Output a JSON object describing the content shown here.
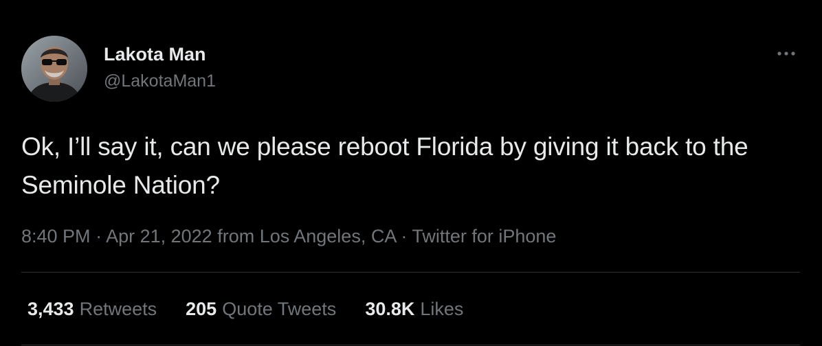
{
  "author": {
    "name": "Lakota Man",
    "handle": "@LakotaMan1"
  },
  "tweet": {
    "text": "Ok, I’ll say it, can we please reboot Florida by giving it back to the Seminole Nation?"
  },
  "meta": {
    "time": "8:40 PM",
    "sep1": " · ",
    "date": "Apr 21, 2022",
    "location": " from Los Angeles, CA",
    "sep2": " · ",
    "source": "Twitter for iPhone"
  },
  "stats": {
    "retweets_count": "3,433",
    "retweets_label": "Retweets",
    "quotes_count": "205",
    "quotes_label": "Quote Tweets",
    "likes_count": "30.8K",
    "likes_label": "Likes"
  },
  "icons": {
    "more": "more-horizontal-icon"
  },
  "colors": {
    "background": "#000000",
    "primary_text": "#e7e9ea",
    "secondary_text": "#71767b",
    "divider": "#2f3336"
  }
}
